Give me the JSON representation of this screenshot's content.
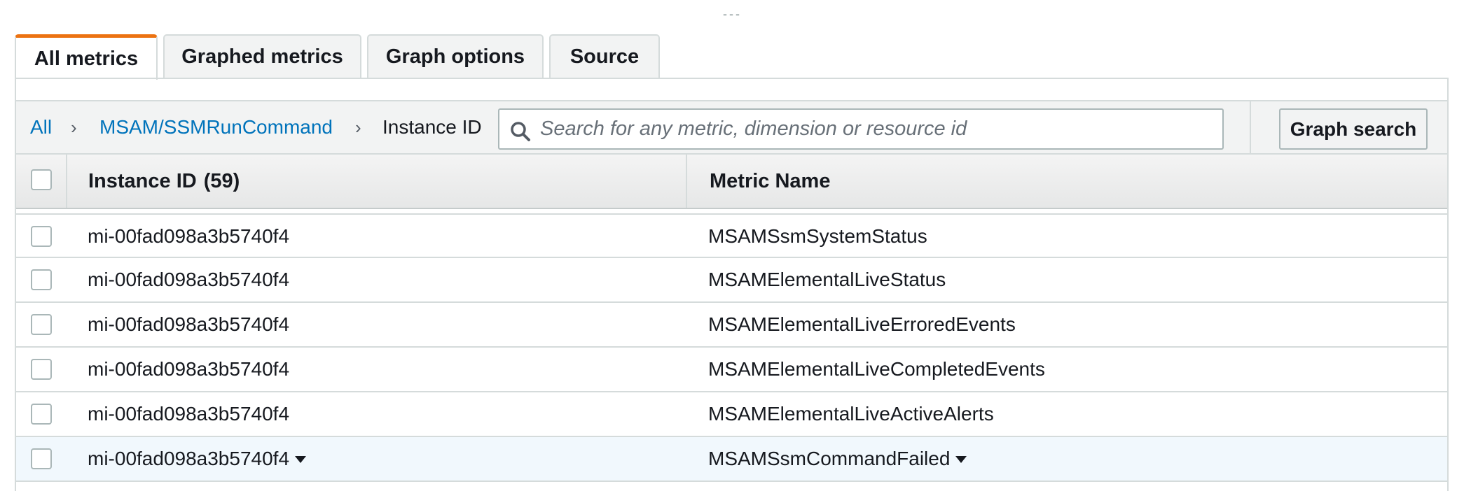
{
  "tabs": [
    {
      "label": "All metrics",
      "active": true
    },
    {
      "label": "Graphed metrics",
      "active": false
    },
    {
      "label": "Graph options",
      "active": false
    },
    {
      "label": "Source",
      "active": false
    }
  ],
  "breadcrumb": {
    "all": "All",
    "namespace": "MSAM/SSMRunCommand",
    "dimension": "Instance ID",
    "separator": "›"
  },
  "search": {
    "placeholder": "Search for any metric, dimension or resource id",
    "value": ""
  },
  "graph_search_label": "Graph search",
  "table": {
    "columns": [
      {
        "label": "Instance ID",
        "count": "(59)"
      },
      {
        "label": "Metric Name"
      }
    ],
    "rows": [
      {
        "instance_id": "mi-00fad098a3b5740f4",
        "metric_name": "MSAMSsmSystemStatus",
        "checked": false,
        "hover": false
      },
      {
        "instance_id": "mi-00fad098a3b5740f4",
        "metric_name": "MSAMElementalLiveStatus",
        "checked": false,
        "hover": false
      },
      {
        "instance_id": "mi-00fad098a3b5740f4",
        "metric_name": "MSAMElementalLiveErroredEvents",
        "checked": false,
        "hover": false
      },
      {
        "instance_id": "mi-00fad098a3b5740f4",
        "metric_name": "MSAMElementalLiveCompletedEvents",
        "checked": false,
        "hover": false
      },
      {
        "instance_id": "mi-00fad098a3b5740f4",
        "metric_name": "MSAMElementalLiveActiveAlerts",
        "checked": false,
        "hover": false
      },
      {
        "instance_id": "mi-00fad098a3b5740f4",
        "metric_name": "MSAMSsmCommandFailed",
        "checked": false,
        "hover": true
      }
    ]
  },
  "colors": {
    "accent_tab": "#ec7211",
    "link": "#0073bb",
    "row_highlight": "#f1f8fd"
  }
}
